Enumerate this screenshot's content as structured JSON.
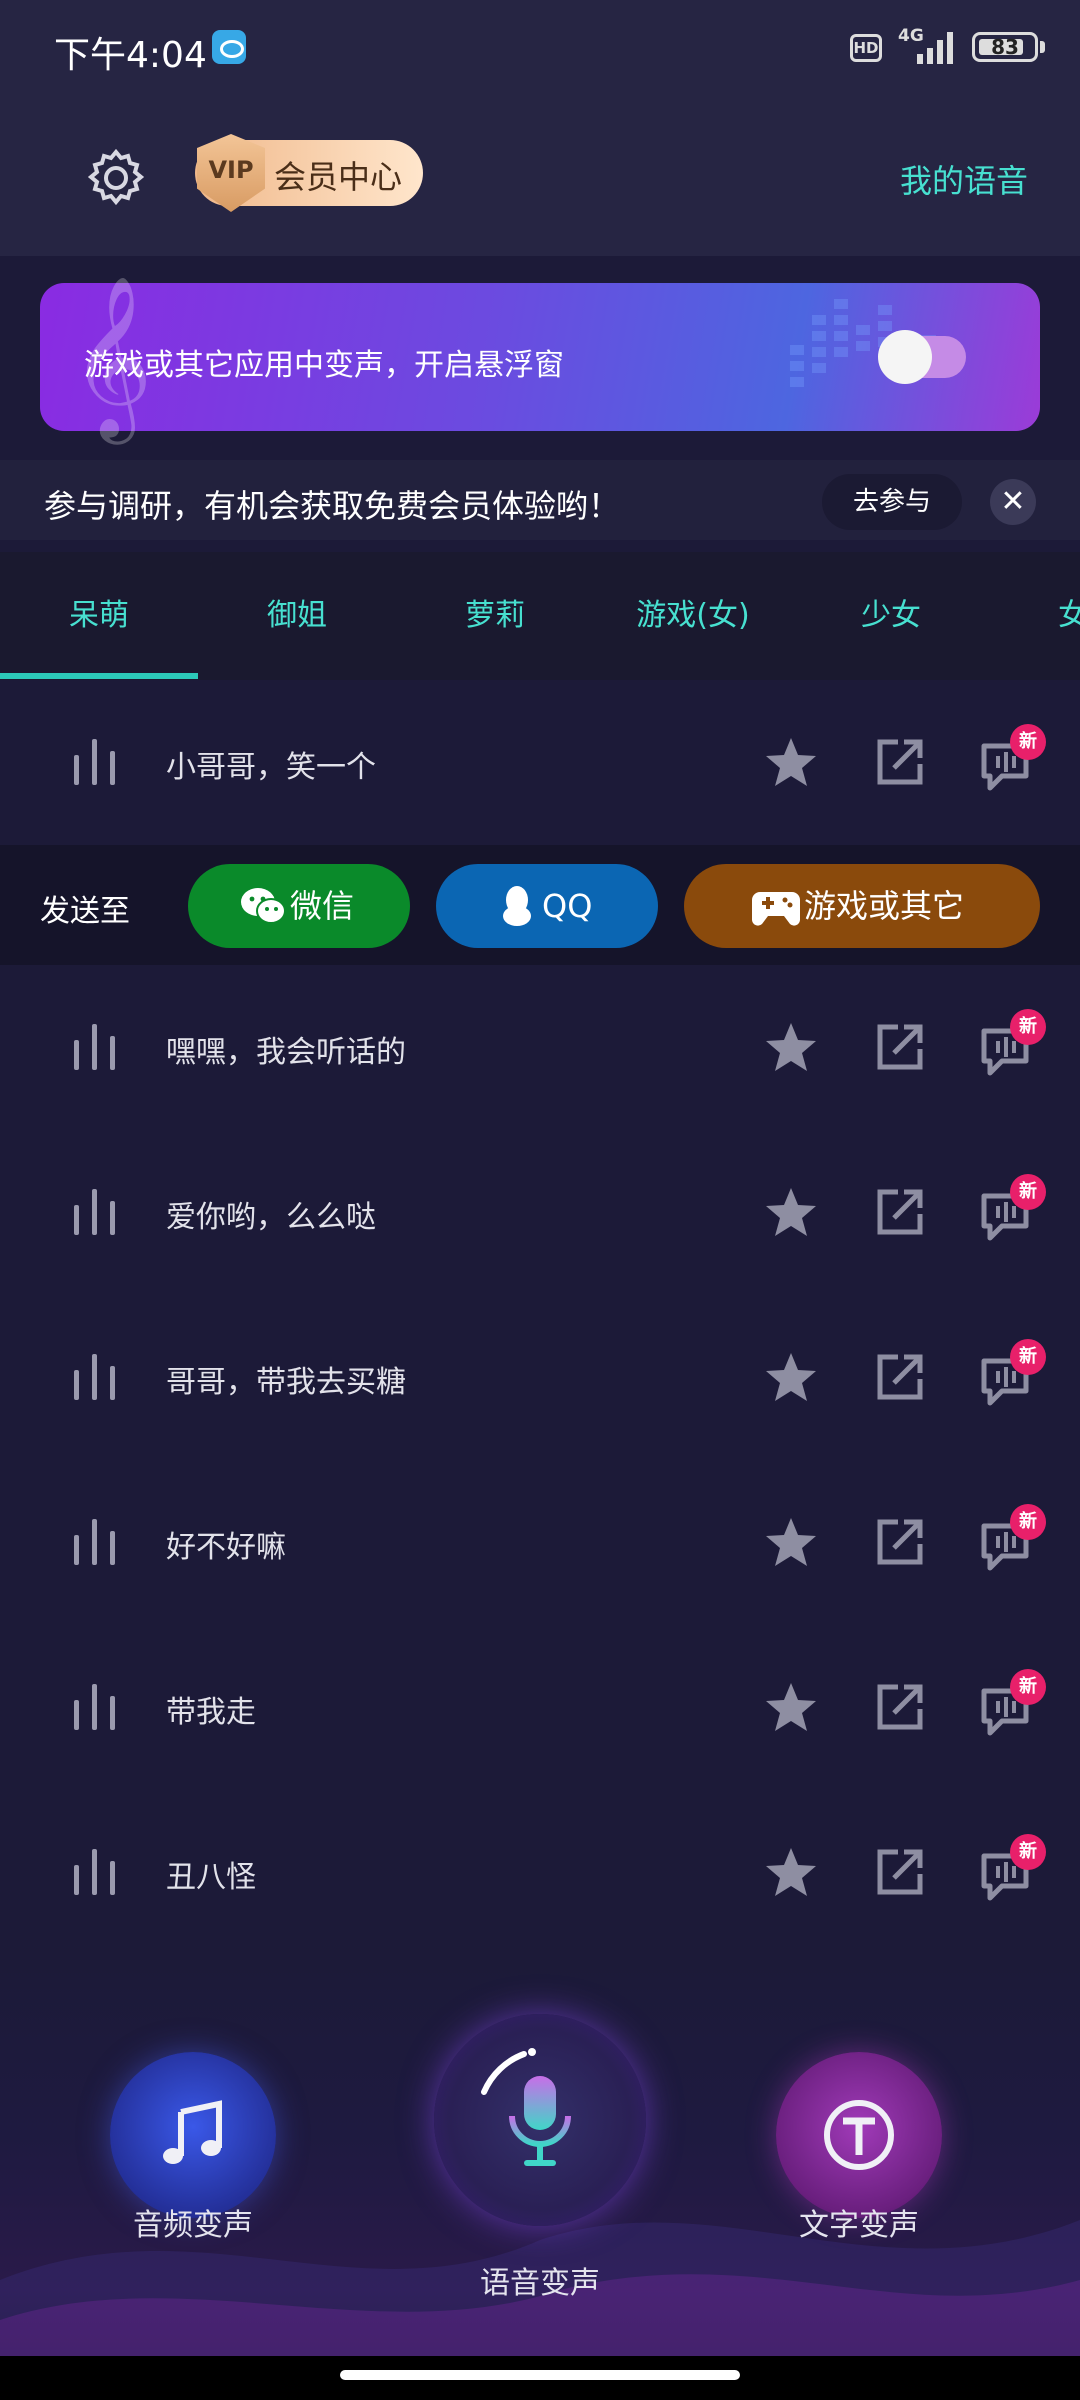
{
  "status_bar": {
    "time": "下午4:04",
    "network": "4G",
    "hd": "HD",
    "battery": "83"
  },
  "header": {
    "vip_badge": "VIP",
    "vip_label": "会员中心",
    "my_voice": "我的语音"
  },
  "banner": {
    "text": "游戏或其它应用中变声，开启悬浮窗",
    "toggle_on": false
  },
  "survey": {
    "text": "参与调研，有机会获取免费会员体验哟！",
    "join_label": "去参与"
  },
  "tabs": [
    "呆萌",
    "御姐",
    "萝莉",
    "游戏(女)",
    "少女",
    "女"
  ],
  "active_tab": 0,
  "send": {
    "label": "发送至",
    "wechat": "微信",
    "qq": "QQ",
    "game": "游戏或其它"
  },
  "voices": [
    {
      "label": "小哥哥，笑一个",
      "new": "新"
    },
    {
      "label": "嘿嘿，我会听话的",
      "new": "新"
    },
    {
      "label": "爱你哟，么么哒",
      "new": "新"
    },
    {
      "label": "哥哥，带我去买糖",
      "new": "新"
    },
    {
      "label": "好不好嘛",
      "new": "新"
    },
    {
      "label": "带我走",
      "new": "新"
    },
    {
      "label": "丑八怪",
      "new": "新"
    }
  ],
  "bottom_nav": {
    "audio": "音频变声",
    "voice": "语音变声",
    "text": "文字变声"
  },
  "colors": {
    "accent": "#47e0d0",
    "badge_new": "#e8206a",
    "wechat": "#0a8a2a",
    "qq": "#0b66b3",
    "game": "#8a4a0c"
  }
}
